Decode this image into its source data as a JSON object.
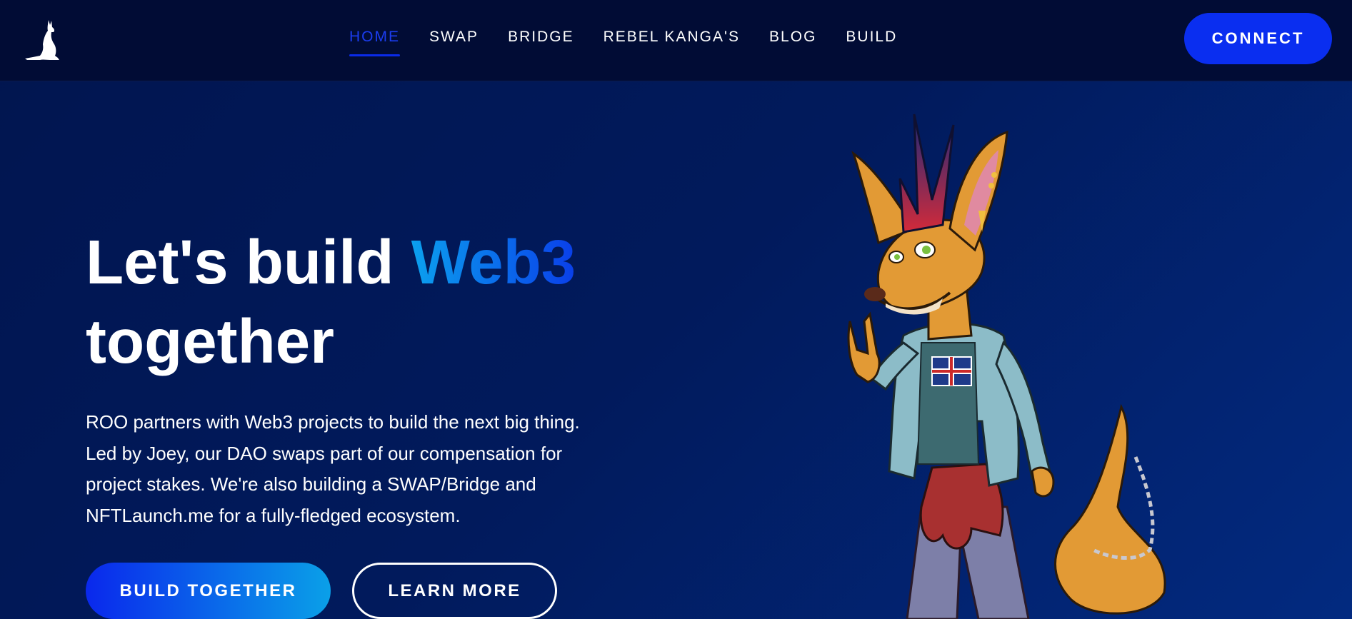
{
  "header": {
    "logo_icon": "kangaroo-logo-icon",
    "nav": [
      {
        "label": "HOME",
        "active": true
      },
      {
        "label": "SWAP",
        "active": false
      },
      {
        "label": "BRIDGE",
        "active": false
      },
      {
        "label": "REBEL KANGA'S",
        "active": false
      },
      {
        "label": "BLOG",
        "active": false
      },
      {
        "label": "BUILD",
        "active": false
      }
    ],
    "connect_label": "CONNECT"
  },
  "hero": {
    "title_part1": "Let's build ",
    "title_accent": "Web3",
    "title_part2": "together",
    "description": "ROO partners with Web3 projects to build the next big thing. Led by Joey, our DAO swaps part of our compensation for project stakes. We're also building a SWAP/Bridge and NFTLaunch.me for a fully-fledged ecosystem.",
    "primary_button": "BUILD TOGETHER",
    "secondary_button": "LEARN MORE",
    "illustration": "punk-kangaroo-mascot"
  },
  "colors": {
    "background": "#01154f",
    "header": "#010c35",
    "accent_blue": "#0a2ef0",
    "gradient_cyan": "#0aa0e8"
  }
}
